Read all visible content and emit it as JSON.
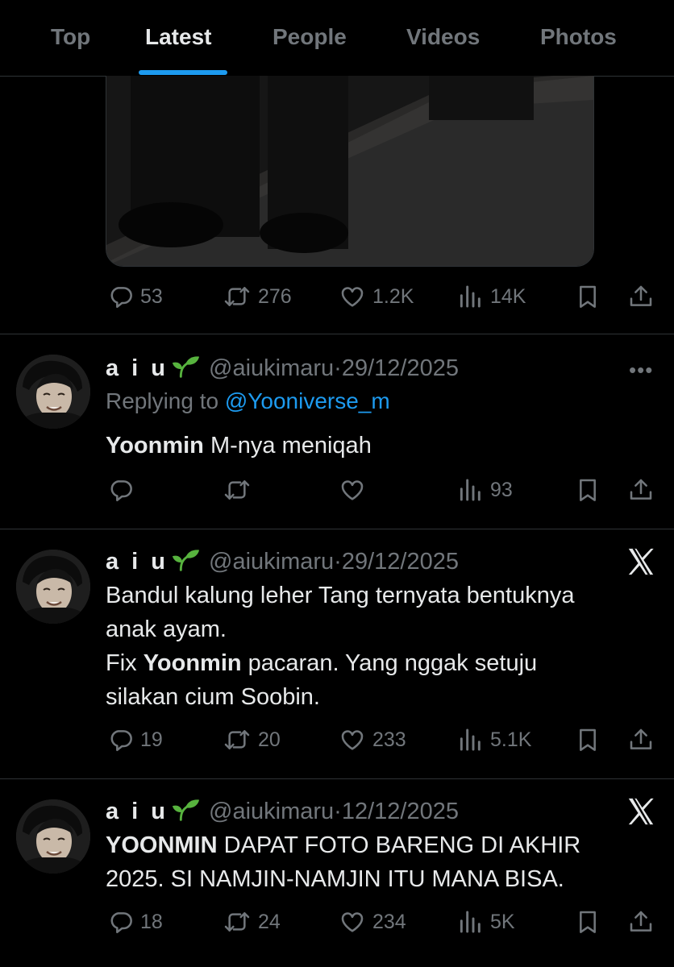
{
  "tabs": [
    {
      "label": "Top"
    },
    {
      "label": "Latest",
      "active": true
    },
    {
      "label": "People"
    },
    {
      "label": "Videos"
    },
    {
      "label": "Photos"
    }
  ],
  "colors": {
    "background": "#000000",
    "accent": "#1d9bf0",
    "muted": "#71767b",
    "text": "#e7e9ea",
    "sprout": "#57b33e"
  },
  "prev_tweet": {
    "stats": {
      "replies": "53",
      "reposts": "276",
      "likes": "1.2K",
      "views": "14K"
    }
  },
  "tweets": [
    {
      "name": "a i u",
      "handle": "@aiukimaru",
      "sep": "·",
      "date": "29/12/2025",
      "reply_prefix": "Replying to",
      "reply_to": "@Yooniverse_m",
      "text_bold": "Yoonmin",
      "text_rest": " M-nya meniqah",
      "stats": {
        "views": "93"
      },
      "menu_icon": "more-dots-icon"
    },
    {
      "name": "a i u",
      "handle": "@aiukimaru",
      "sep": "·",
      "date": "29/12/2025",
      "line1": "Bandul kalung leher Tang ternyata bentuknya",
      "line2": "anak ayam.",
      "line3_pre": "Fix ",
      "line3_bold": "Yoonmin",
      "line3_post": " pacaran. Yang nggak setuju",
      "line4": "silakan cium Soobin.",
      "stats": {
        "replies": "19",
        "reposts": "20",
        "likes": "233",
        "views": "5.1K"
      },
      "menu_icon": "x-logo-icon"
    },
    {
      "name": "a i u",
      "handle": "@aiukimaru",
      "sep": "·",
      "date": "12/12/2025",
      "line1_bold": "YOONMIN",
      "line1_rest": " DAPAT FOTO BARENG DI AKHIR",
      "line2": "2025. SI NAMJIN-NAMJIN ITU MANA BISA.",
      "stats": {
        "replies": "18",
        "reposts": "24",
        "likes": "234",
        "views": "5K"
      },
      "menu_icon": "x-logo-icon"
    }
  ]
}
